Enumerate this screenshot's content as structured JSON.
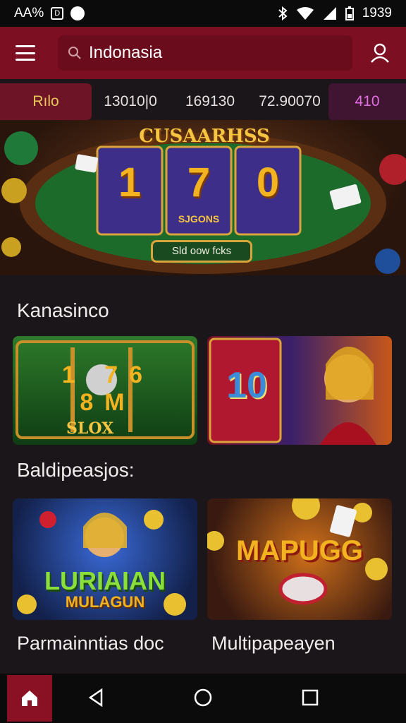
{
  "status_bar": {
    "left_text": "AA%",
    "time": "1939"
  },
  "header": {
    "search_value": "Indonasia"
  },
  "tabs": [
    {
      "label": "Rılo"
    },
    {
      "label": "13010|0"
    },
    {
      "label": "169130"
    },
    {
      "label": "72.90070"
    },
    {
      "label": "410"
    }
  ],
  "banner": {
    "title": "CUSAARHSS",
    "reel_values": [
      "1",
      "7",
      "0"
    ],
    "reel_sub": "SJGONS",
    "button_label": "Sld oow fcks"
  },
  "sections": [
    {
      "title": "Kanasinco",
      "cards": [
        {
          "label": "SLOX",
          "sub": "1 76 8M"
        },
        {
          "label": "10"
        }
      ]
    },
    {
      "title": "Baldipeasjos:",
      "cards": [
        {
          "label": "LURIAIAN",
          "sub": "MULAGUN"
        },
        {
          "label": "MAPUGG"
        }
      ]
    }
  ],
  "captions": [
    "Parmainntias doc",
    "Multipapeayen"
  ],
  "colors": {
    "header": "#7d0f22",
    "accent_gold": "#e8c85a",
    "background": "#1a1619"
  },
  "icons": [
    "menu-icon",
    "search-icon",
    "user-icon",
    "home-icon",
    "back-icon",
    "circle-home-icon",
    "recents-icon"
  ]
}
